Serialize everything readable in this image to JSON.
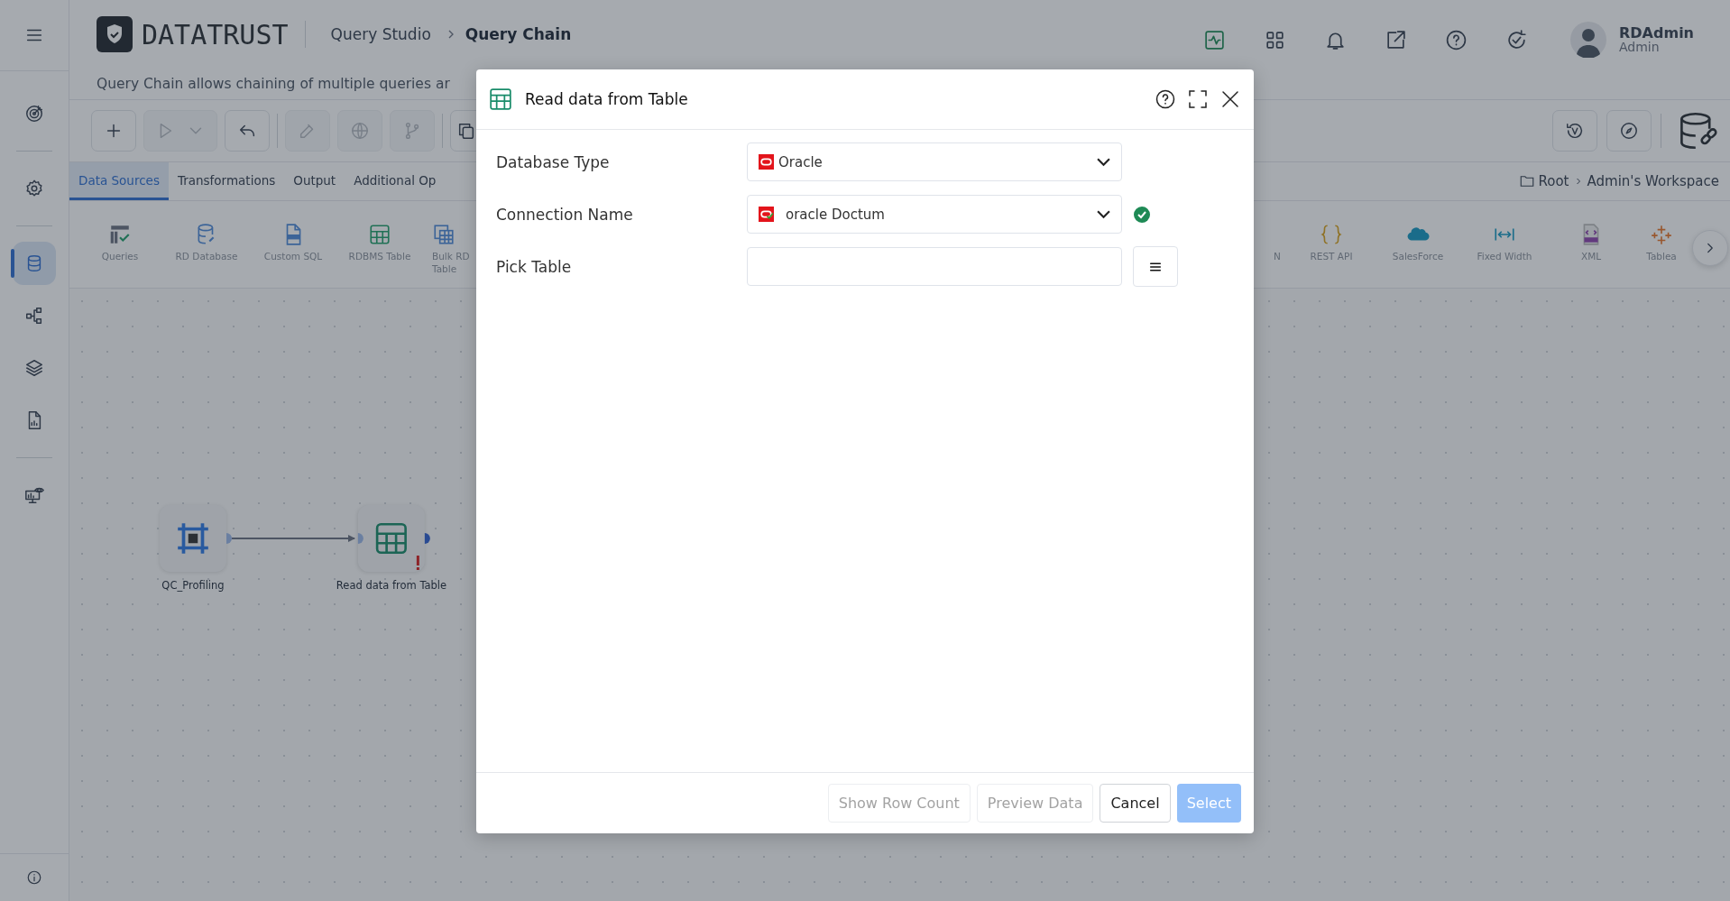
{
  "sidebar": {
    "items": [
      {
        "selected": false
      },
      {
        "selected": false
      },
      {
        "selected": true
      },
      {
        "selected": false
      },
      {
        "selected": false
      },
      {
        "selected": false
      },
      {
        "selected": false
      }
    ]
  },
  "header": {
    "logo": "DATATRUST",
    "breadcrumb": [
      "Query Studio",
      "Query Chain"
    ],
    "user": {
      "name": "RDAdmin",
      "role": "Admin"
    }
  },
  "subtitle": "Query Chain allows chaining of multiple queries ar",
  "toolbar": {
    "buttons": [
      {
        "disabled": false
      },
      {
        "disabled": true
      },
      {
        "disabled": false
      },
      {
        "disabled": true
      },
      {
        "disabled": true
      },
      {
        "disabled": true
      }
    ]
  },
  "tabs": [
    {
      "label": "Data Sources",
      "selected": true
    },
    {
      "label": "Transformations",
      "selected": false
    },
    {
      "label": "Output",
      "selected": false
    },
    {
      "label": "Additional Op",
      "selected": false
    }
  ],
  "location": [
    "Root",
    "Admin's Workspace"
  ],
  "palette": {
    "left": [
      {
        "lines": [
          "Queries"
        ]
      },
      {
        "lines": [
          "RD Database"
        ]
      },
      {
        "lines": [
          "Custom SQL"
        ]
      },
      {
        "lines": [
          "RDBMS Table"
        ]
      },
      {
        "lines": [
          "Bulk RD",
          "Table"
        ]
      }
    ],
    "right": [
      {
        "lines": [
          "N"
        ]
      },
      {
        "lines": [
          "REST API"
        ]
      },
      {
        "lines": [
          "SalesForce"
        ]
      },
      {
        "lines": [
          "Fixed Width"
        ]
      },
      {
        "lines": [
          "XML"
        ]
      },
      {
        "lines": [
          "Tablea"
        ]
      }
    ]
  },
  "canvas": {
    "nodes": [
      {
        "label": "QC_Profiling",
        "kind": "profiling",
        "warning": false
      },
      {
        "label": "Read data from Table",
        "kind": "table",
        "warning": true
      }
    ]
  },
  "modal": {
    "title": "Read data from Table",
    "fields": [
      {
        "label": "Database Type",
        "kind": "select",
        "value": "Oracle",
        "verified": false
      },
      {
        "label": "Connection Name",
        "kind": "select",
        "value": "oracle Doctum",
        "verified": true
      },
      {
        "label": "Pick Table",
        "kind": "picker"
      }
    ],
    "buttons": [
      {
        "label": "Show Row Count",
        "kind": "default",
        "disabled": true
      },
      {
        "label": "Preview Data",
        "kind": "default",
        "disabled": true
      },
      {
        "label": "Cancel",
        "kind": "default",
        "disabled": false
      },
      {
        "label": "Select",
        "kind": "primary",
        "disabled": true
      }
    ]
  }
}
